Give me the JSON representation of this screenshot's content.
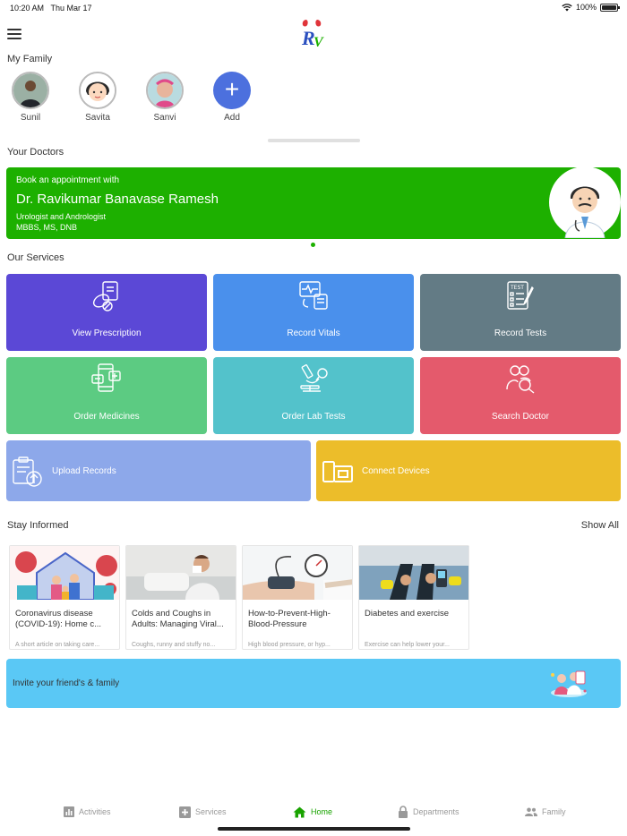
{
  "status": {
    "time": "10:20 AM",
    "date": "Thu Mar 17",
    "battery": "100%"
  },
  "family": {
    "title": "My Family",
    "members": [
      {
        "name": "Sunil"
      },
      {
        "name": "Savita"
      },
      {
        "name": "Sanvi"
      }
    ],
    "add_label": "Add"
  },
  "doctors": {
    "title": "Your Doctors",
    "card": {
      "book_label": "Book an appointment with",
      "name": "Dr. Ravikumar Banavase Ramesh",
      "specialty": "Urologist and Andrologist",
      "degrees": "MBBS, MS, DNB"
    }
  },
  "services": {
    "title": "Our Services",
    "items": [
      {
        "label": "View Prescription",
        "color": "#5b48d6"
      },
      {
        "label": "Record Vitals",
        "color": "#4a90ec"
      },
      {
        "label": "Record Tests",
        "color": "#637b85"
      },
      {
        "label": "Order Medicines",
        "color": "#5ccb82"
      },
      {
        "label": "Order Lab Tests",
        "color": "#53c2cb"
      },
      {
        "label": "Search Doctor",
        "color": "#e45a6c"
      },
      {
        "label": "Upload Records",
        "color": "#8da8ea"
      },
      {
        "label": "Connect Devices",
        "color": "#ecbd2a"
      }
    ]
  },
  "informed": {
    "title": "Stay Informed",
    "show_all": "Show All",
    "articles": [
      {
        "title": "Coronavirus disease (COVID-19): Home c...",
        "snippet": "A short article on taking care..."
      },
      {
        "title": "Colds and Coughs in Adults: Managing Viral...",
        "snippet": "Coughs, runny and stuffy no..."
      },
      {
        "title": "How-to-Prevent-High-Blood-Pressure",
        "snippet": "High blood pressure, or hyp..."
      },
      {
        "title": "Diabetes and exercise",
        "snippet": "Exercise can help lower your..."
      }
    ]
  },
  "invite": {
    "label": "Invite your friend's & family"
  },
  "tabs": [
    {
      "label": "Activities"
    },
    {
      "label": "Services"
    },
    {
      "label": "Home"
    },
    {
      "label": "Departments"
    },
    {
      "label": "Family"
    }
  ],
  "colors": {
    "accent_green": "#1db000",
    "tab_active": "#19a300",
    "add_blue": "#4c70de",
    "invite": "#5ac8f5"
  }
}
